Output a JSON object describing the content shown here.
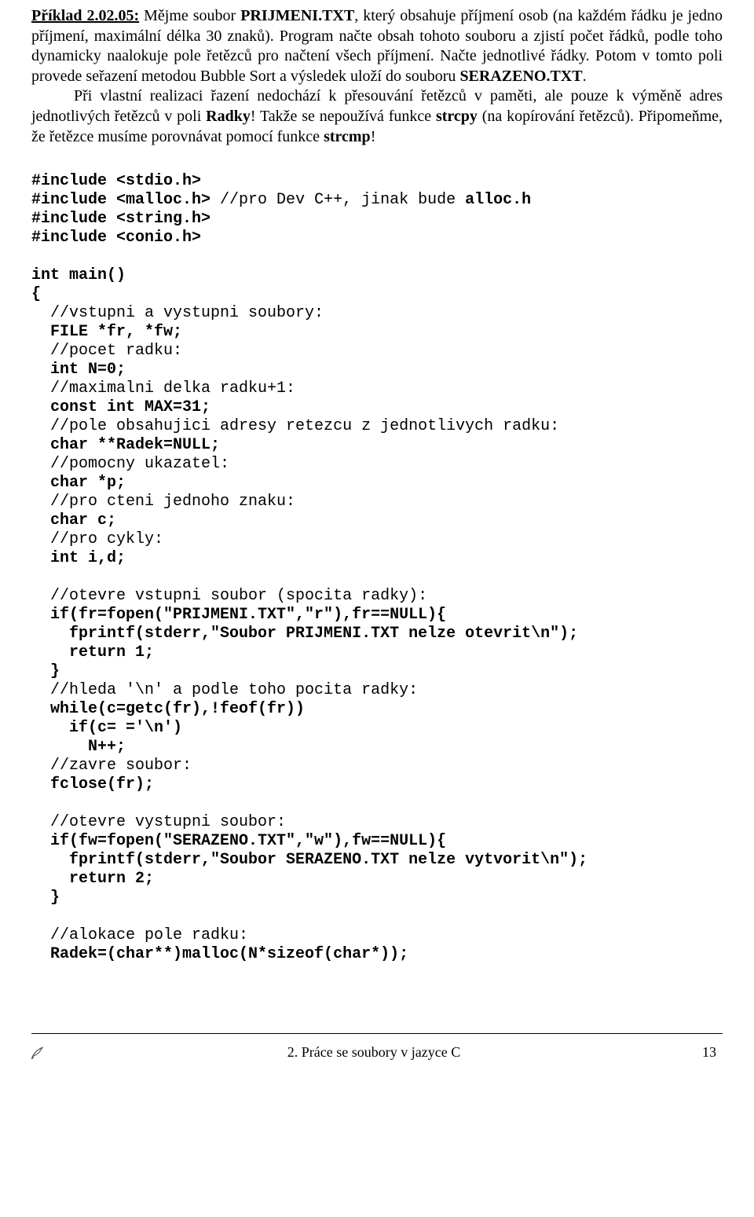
{
  "header": {
    "example_label": "Příklad 2.02.05:",
    "p1_pre": " Mějme soubor ",
    "file1": "PRIJMENI.TXT",
    "p1_post": ", který obsahuje příjmení osob (na každém řádku je jedno příjmení, maximální délka 30 znaků). Program načte obsah tohoto souboru a zjistí počet řádků, podle toho dynamicky naalokuje pole řetězců pro načtení všech příjmení. Načte jednotlivé řádky. Potom v tomto poli provede seřazení metodou Bubble Sort a výsledek uloží do souboru ",
    "file2": "SERAZENO.TXT",
    "p1_end": ".",
    "p2_pre": "Při vlastní realizaci řazení nedochází k přesouvání řetězců v paměti, ale pouze k výměně adres jednotlivých řetězců v poli ",
    "radky": "Radky",
    "p2_mid": "! Takže se nepoužívá funkce ",
    "strcpy": "strcpy",
    "p2_after_strcpy": " (na kopírování řetězců). Připomeňme, že řetězce musíme porovnávat pomocí funkce ",
    "strcmp": "strcmp",
    "p2_end": "!"
  },
  "code": {
    "l01": "#include <stdio.h>",
    "l02a": "#include <malloc.h> ",
    "l02b": "//pro Dev C++, jinak bude ",
    "l02c": "alloc.h",
    "l03": "#include <string.h>",
    "l04": "#include <conio.h>",
    "l05": "",
    "l06": "int main()",
    "l07": "{",
    "c01": "  //vstupni a vystupni soubory:",
    "l08": "  FILE *fr, *fw;",
    "c02": "  //pocet radku:",
    "l09": "  int N=0;",
    "c03": "  //maximalni delka radku+1:",
    "l10": "  const int MAX=31;",
    "c04": "  //pole obsahujici adresy retezcu z jednotlivych radku:",
    "l11": "  char **Radek=NULL;",
    "c05": "  //pomocny ukazatel:",
    "l12": "  char *p;",
    "c06": "  //pro cteni jednoho znaku:",
    "l13": "  char c;",
    "c07": "  //pro cykly:",
    "l14": "  int i,d;",
    "l15": "",
    "c08": "  //otevre vstupni soubor (spocita radky):",
    "l16": "  if(fr=fopen(\"PRIJMENI.TXT\",\"r\"),fr==NULL){",
    "l17": "    fprintf(stderr,\"Soubor PRIJMENI.TXT nelze otevrit\\n\");",
    "l18": "    return 1;",
    "l19": "  }",
    "c09": "  //hleda '\\n' a podle toho pocita radky:",
    "l20": "  while(c=getc(fr),!feof(fr))",
    "l21": "    if(c= ='\\n')",
    "l22": "      N++;",
    "c10": "  //zavre soubor:",
    "l23": "  fclose(fr);",
    "l24": "",
    "c11": "  //otevre vystupni soubor:",
    "l25": "  if(fw=fopen(\"SERAZENO.TXT\",\"w\"),fw==NULL){",
    "l26": "    fprintf(stderr,\"Soubor SERAZENO.TXT nelze vytvorit\\n\");",
    "l27": "    return 2;",
    "l28": "  }",
    "l29": "",
    "c12": "  //alokace pole radku:",
    "l30": "  Radek=(char**)malloc(N*sizeof(char*));"
  },
  "footer": {
    "center": "2. Práce se soubory v jazyce C",
    "page": "13"
  }
}
